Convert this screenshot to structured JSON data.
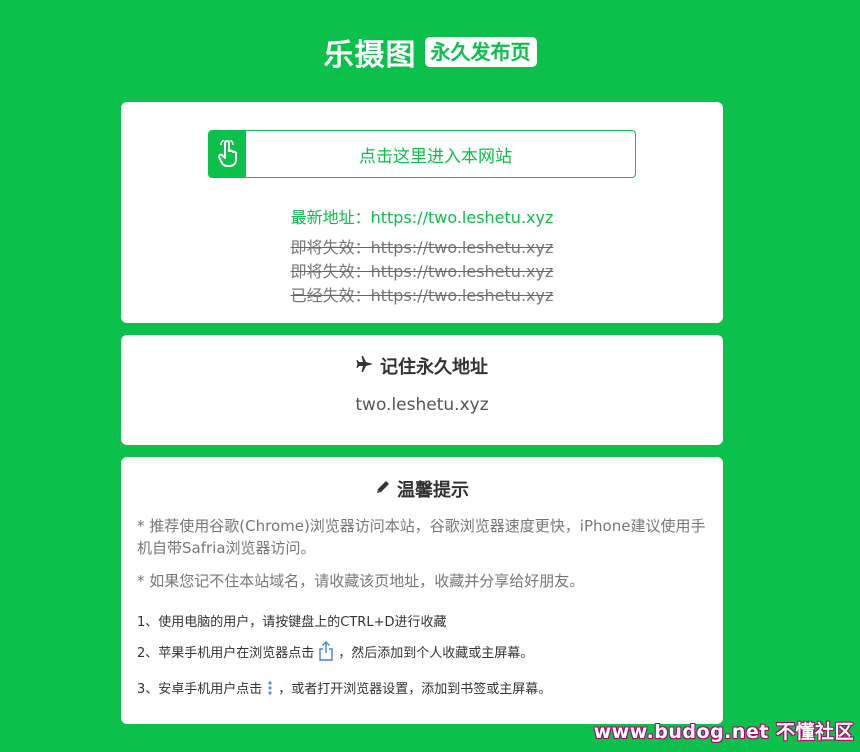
{
  "header": {
    "brand_name": "乐摄图",
    "badge": "永久发布页"
  },
  "entry": {
    "button_label": "点击这里进入本网站",
    "icon": "hand-pointer-icon"
  },
  "addresses": {
    "latest": "最新地址：https://two.leshetu.xyz",
    "expiring": [
      "即将失效：https://two.leshetu.xyz",
      "即将失效：https://two.leshetu.xyz",
      "已经失效：https://two.leshetu.xyz"
    ]
  },
  "permanent": {
    "title": "记住永久地址",
    "icon": "plane-icon",
    "address": "two.leshetu.xyz"
  },
  "tips": {
    "title": "温馨提示",
    "icon": "pencil-icon",
    "notes": [
      "* 推荐使用谷歌(Chrome)浏览器访问本站，谷歌浏览器速度更快，iPhone建议使用手机自带Safria浏览器访问。",
      "* 如果您记不住本站域名，请收藏该页地址，收藏并分享给好朋友。"
    ],
    "steps": {
      "pc": "1、使用电脑的用户，请按键盘上的CTRL+D进行收藏",
      "apple_before": "2、苹果手机用户在浏览器点击",
      "apple_after": "，然后添加到个人收藏或主屏幕。",
      "android_before": "3、安卓手机用户点击",
      "android_after": "，或者打开浏览器设置，添加到书签或主屏幕。"
    }
  },
  "watermark": "www.budog.net 不懂社区",
  "colors": {
    "brand_green": "#0cc04c",
    "card_bg": "#ffffff"
  }
}
